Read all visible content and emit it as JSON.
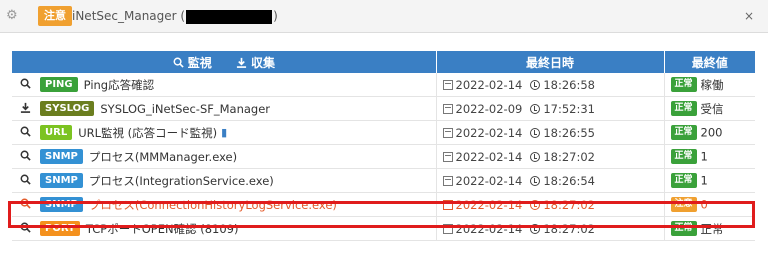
{
  "header": {
    "badge": "注意",
    "title_prefix": "iNetSec_Manager (",
    "title_suffix": ")",
    "close": "×",
    "gear_icon": "gear-icon"
  },
  "table": {
    "col_monitor": "監視",
    "col_collect": "収集",
    "col_last_time": "最終日時",
    "col_last_value": "最終値",
    "rows": [
      {
        "action_icon": "search-icon",
        "proto": "PING",
        "proto_color": "#3aa13a",
        "name": "Ping応答確認",
        "date": "2022-02-14",
        "time": "18:26:58",
        "status": "正常",
        "value": "稼働",
        "alert": false
      },
      {
        "action_icon": "download-icon",
        "proto": "SYSLOG",
        "proto_color": "#6b7e1f",
        "name": "SYSLOG_iNetSec-SF_Manager",
        "date": "2022-02-09",
        "time": "17:52:31",
        "status": "正常",
        "value": "受信",
        "alert": false
      },
      {
        "action_icon": "search-icon",
        "proto": "URL",
        "proto_color": "#7cc321",
        "name": "URL監視 (応答コード監視)",
        "date": "2022-02-14",
        "time": "18:26:55",
        "status": "正常",
        "value": "200",
        "alert": false,
        "doc_icon": true
      },
      {
        "action_icon": "search-icon",
        "proto": "SNMP",
        "proto_color": "#3391d4",
        "name": "プロセス(MMManager.exe)",
        "date": "2022-02-14",
        "time": "18:27:02",
        "status": "正常",
        "value": "1",
        "alert": false
      },
      {
        "action_icon": "search-icon",
        "proto": "SNMP",
        "proto_color": "#3391d4",
        "name": "プロセス(IntegrationService.exe)",
        "date": "2022-02-14",
        "time": "18:26:54",
        "status": "正常",
        "value": "1",
        "alert": false
      },
      {
        "action_icon": "search-icon",
        "proto": "SNMP",
        "proto_color": "#3391d4",
        "name": "プロセス(ConnectionHistoryLogService.exe)",
        "date": "2022-02-14",
        "time": "18:27:02",
        "status": "注意",
        "value": "0",
        "alert": true
      },
      {
        "action_icon": "search-icon",
        "proto": "PORT",
        "proto_color": "#f4911e",
        "name": "TCPポートOPEN確認 (8109)",
        "date": "2022-02-14",
        "time": "18:27:02",
        "status": "正常",
        "value": "正常",
        "alert": false
      }
    ]
  }
}
